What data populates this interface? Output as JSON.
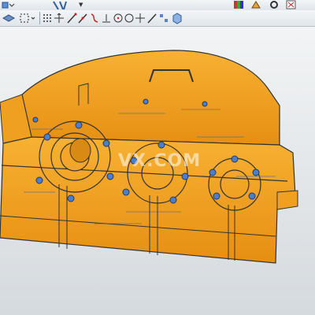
{
  "toolbar_top": {
    "items": [
      {
        "icon": "mode-select-icon"
      },
      {
        "icon": "dropdown-chevron-icon"
      },
      {
        "icon": "toolbar-options-icon"
      },
      {
        "icon": "part-color-icon"
      },
      {
        "icon": "paint-icon"
      },
      {
        "icon": "settings-icon"
      },
      {
        "icon": "close-box-icon"
      }
    ]
  },
  "toolbar_main": {
    "items": [
      {
        "icon": "layer-icon"
      },
      {
        "icon": "select-box-icon"
      },
      {
        "icon": "snap-grid-icon"
      },
      {
        "icon": "snap-move-icon"
      },
      {
        "icon": "snap-line-icon"
      },
      {
        "icon": "snap-angle-icon"
      },
      {
        "icon": "snap-curve-icon"
      },
      {
        "icon": "snap-circle-icon"
      },
      {
        "icon": "snap-center-icon"
      },
      {
        "icon": "snap-point-icon"
      },
      {
        "icon": "snap-edge-icon"
      },
      {
        "icon": "snap-pin-icon"
      },
      {
        "icon": "view-cube-icon"
      }
    ]
  },
  "viewport": {
    "watermark": "VX.COM",
    "model_color": "#f5a623"
  }
}
